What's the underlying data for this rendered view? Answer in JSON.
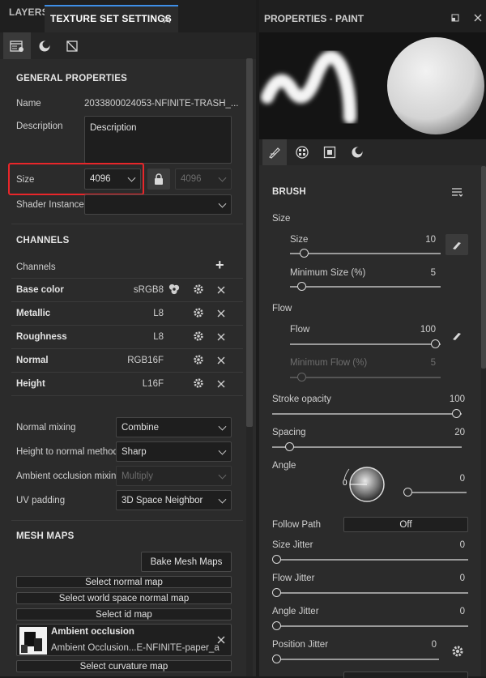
{
  "left_panel": {
    "tabs": {
      "layers": "LAYERS",
      "texture_set_settings": "TEXTURE SET SETTINGS"
    },
    "general": {
      "heading": "GENERAL PROPERTIES",
      "name_label": "Name",
      "name_value": "2033800024053-NFINITE-TRASH_...",
      "description_label": "Description",
      "description_value": "Description",
      "size_label": "Size",
      "size_value": "4096",
      "size_locked_value": "4096",
      "shader_label": "Shader Instance",
      "shader_value": ""
    },
    "channels": {
      "heading": "CHANNELS",
      "list_label": "Channels",
      "add_symbol": "+",
      "items": [
        {
          "name": "Base color",
          "format": "sRGB8"
        },
        {
          "name": "Metallic",
          "format": "L8"
        },
        {
          "name": "Roughness",
          "format": "L8"
        },
        {
          "name": "Normal",
          "format": "RGB16F"
        },
        {
          "name": "Height",
          "format": "L16F"
        }
      ]
    },
    "mixing": {
      "normal_mixing_label": "Normal mixing",
      "normal_mixing_value": "Combine",
      "height_to_normal_label": "Height to normal method",
      "height_to_normal_value": "Sharp",
      "ao_mixing_label": "Ambient occlusion mixing",
      "ao_mixing_value": "Multiply",
      "uv_padding_label": "UV padding",
      "uv_padding_value": "3D Space Neighbor"
    },
    "mesh_maps": {
      "heading": "MESH MAPS",
      "bake_button": "Bake Mesh Maps",
      "select_normal": "Select normal map",
      "select_world_normal": "Select world space normal map",
      "select_id": "Select id map",
      "ao_title": "Ambient occlusion",
      "ao_file": "Ambient Occlusion...E-NFINITE-paper_a",
      "select_curvature": "Select curvature map"
    }
  },
  "right_panel": {
    "title": "PROPERTIES - PAINT",
    "brush_heading": "BRUSH",
    "size_group": "Size",
    "size_label": "Size",
    "size_value": "10",
    "size_fraction": 0.07,
    "min_size_label": "Minimum Size (%)",
    "min_size_value": "5",
    "min_size_fraction": 0.05,
    "flow_group": "Flow",
    "flow_label": "Flow",
    "flow_value": "100",
    "flow_fraction": 1.0,
    "min_flow_label": "Minimum Flow (%)",
    "min_flow_value": "5",
    "min_flow_fraction": 0.05,
    "stroke_opacity_label": "Stroke opacity",
    "stroke_opacity_value": "100",
    "stroke_opacity_fraction": 1.0,
    "spacing_label": "Spacing",
    "spacing_value": "20",
    "spacing_fraction": 0.07,
    "angle_label": "Angle",
    "angle_dial_value": "0",
    "angle_value": "0",
    "angle_fraction": 0.0,
    "follow_path_label": "Follow Path",
    "follow_path_value": "Off",
    "size_jitter_label": "Size Jitter",
    "size_jitter_value": "0",
    "flow_jitter_label": "Flow Jitter",
    "flow_jitter_value": "0",
    "angle_jitter_label": "Angle Jitter",
    "angle_jitter_value": "0",
    "position_jitter_label": "Position Jitter",
    "position_jitter_value": "0"
  },
  "colors": {
    "highlight_red": "#e8262a",
    "panel_bg": "#2b2b2b",
    "tab_bg": "#1f1f1f",
    "active_tab_underline": "#3d8ee6"
  }
}
